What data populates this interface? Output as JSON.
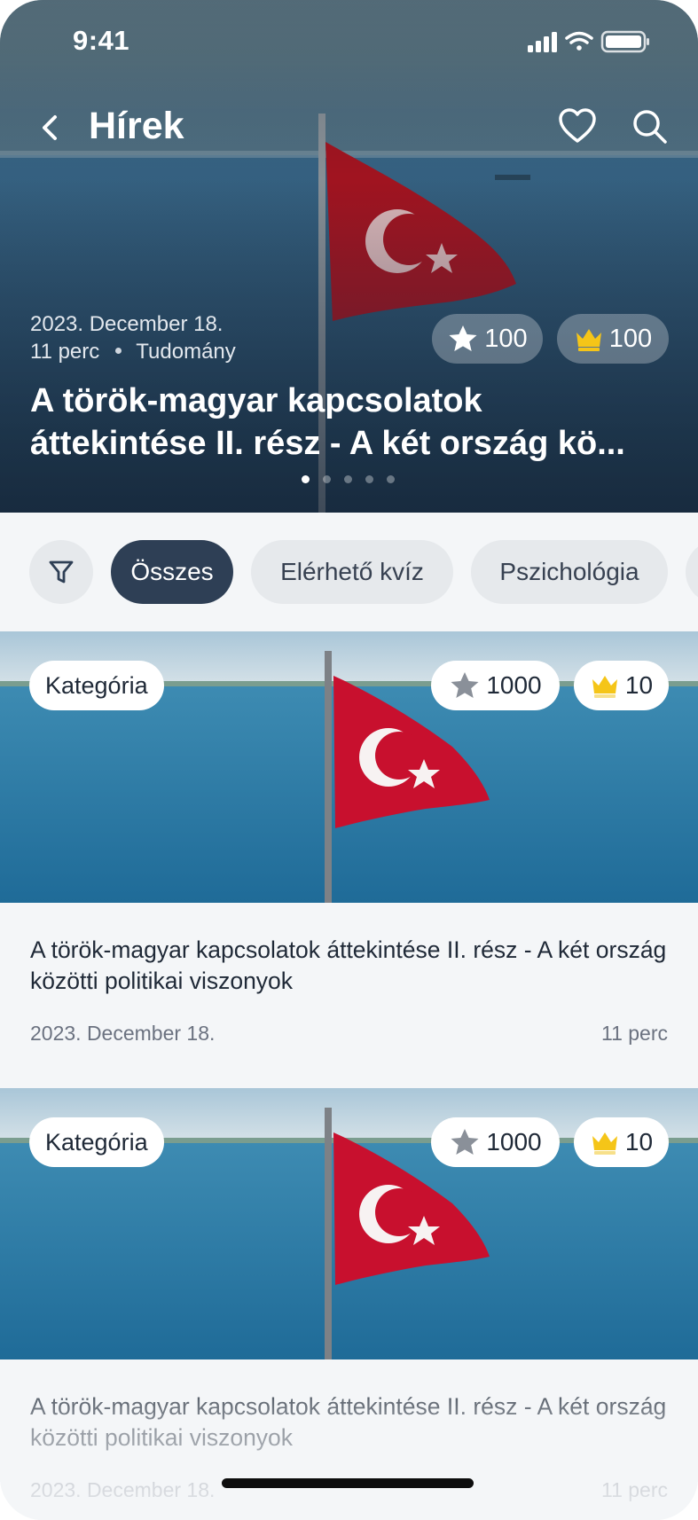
{
  "status_bar": {
    "time": "9:41"
  },
  "nav": {
    "title": "Hírek"
  },
  "hero": {
    "date": "2023. December 18.",
    "read_time": "11 perc",
    "category": "Tudomány",
    "title_line1": "A török-magyar kapcsolatok",
    "title_line2": "áttekintése II. rész - A két ország kö...",
    "stars": "100",
    "crowns": "100",
    "slide_count": 5,
    "active_slide": 1
  },
  "filters": {
    "chips": [
      {
        "label": "Összes",
        "active": true
      },
      {
        "label": "Elérhető kvíz",
        "active": false
      },
      {
        "label": "Pszichológia",
        "active": false
      }
    ]
  },
  "articles": [
    {
      "tag": "Kategória",
      "stars": "1000",
      "crowns": "10",
      "title": "A török-magyar kapcsolatok áttekintése II. rész - A két ország közötti politikai viszonyok",
      "date": "2023. December 18.",
      "read_time": "11 perc"
    },
    {
      "tag": "Kategória",
      "stars": "1000",
      "crowns": "10",
      "title": "A török-magyar kapcsolatok áttekintése II. rész - A két ország közötti politikai viszonyok",
      "date": "2023. December 18.",
      "read_time": "11 perc"
    }
  ],
  "colors": {
    "accent_dark": "#2e3f55",
    "chip_bg": "#e6e9ec",
    "flag_red": "#c8102e",
    "crown_yellow": "#f5c518",
    "star_gray": "#8a9099"
  },
  "icons": {
    "back": "chevron-left-icon",
    "favorite": "heart-icon",
    "search": "search-icon",
    "filter": "funnel-icon",
    "star": "star-icon",
    "crown": "crown-icon"
  }
}
